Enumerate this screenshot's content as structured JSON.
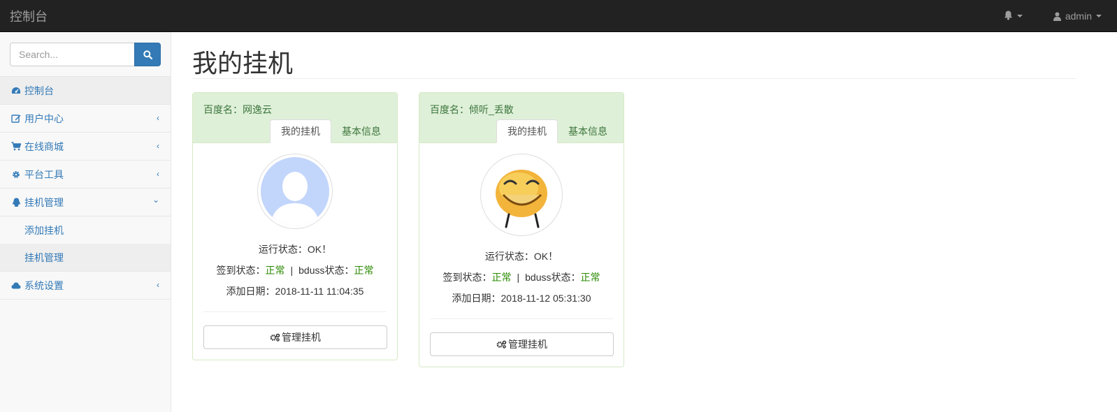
{
  "navbar": {
    "brand": "控制台",
    "user_label": "admin",
    "icons": {
      "notifications": "bell-icon",
      "user": "user-icon"
    }
  },
  "sidebar": {
    "search_placeholder": "Search...",
    "items": [
      {
        "label": "控制台",
        "icon": "dashboard-icon",
        "active": true
      },
      {
        "label": "用户中心",
        "icon": "edit-icon",
        "arrow": "‹"
      },
      {
        "label": "在线商城",
        "icon": "cart-icon",
        "arrow": "‹"
      },
      {
        "label": "平台工具",
        "icon": "gear-icon",
        "arrow": "‹"
      },
      {
        "label": "挂机管理",
        "icon": "qq-icon",
        "arrow": "⌄"
      },
      {
        "label": "系统设置",
        "icon": "cloud-icon",
        "arrow": "‹"
      }
    ],
    "submenu": [
      {
        "label": "添加挂机"
      },
      {
        "label": "挂机管理",
        "active": true
      }
    ]
  },
  "main": {
    "title": "我的挂机",
    "cards": [
      {
        "baidu_name": "百度名：网逸云",
        "tabs": [
          "我的挂机",
          "基本信息"
        ],
        "run_status_label": "运行状态：",
        "run_status_value": "OK！",
        "sign_label": "签到状态：",
        "sign_value": "正常",
        "separator": "|",
        "bduss_label": "bduss状态：",
        "bduss_value": "正常",
        "date_label": "添加日期：",
        "date_value": "2018-11-11 11:04:35",
        "button_label": "管理挂机"
      },
      {
        "baidu_name": "百度名：倾听_丢散",
        "tabs": [
          "我的挂机",
          "基本信息"
        ],
        "run_status_label": "运行状态：",
        "run_status_value": "OK！",
        "sign_label": "签到状态：",
        "sign_value": "正常",
        "separator": "|",
        "bduss_label": "bduss状态：",
        "bduss_value": "正常",
        "date_label": "添加日期：",
        "date_value": "2018-11-12 05:31:30",
        "button_label": "管理挂机"
      }
    ]
  },
  "colors": {
    "navbar_bg": "#222222",
    "link_blue": "#337ab7",
    "panel_head_bg": "#dff0d8",
    "status_green": "#2a8a00"
  }
}
